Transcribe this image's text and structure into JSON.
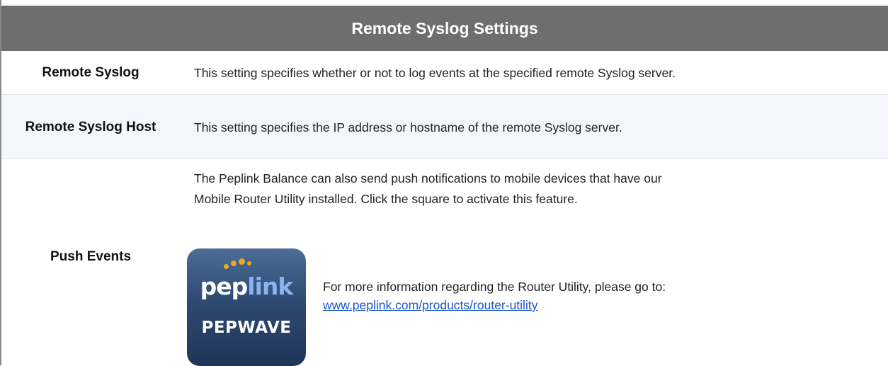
{
  "header": {
    "title": "Remote Syslog Settings"
  },
  "rows": [
    {
      "label": "Remote Syslog",
      "description": "This setting specifies whether or not to log events at the specified remote Syslog server."
    },
    {
      "label": "Remote Syslog Host",
      "description": "This setting specifies the IP address or hostname of the remote Syslog server."
    },
    {
      "label": "Push Events",
      "intro": "The Peplink Balance can also send push notifications to mobile devices that have our Mobile Router Utility installed. Click the square to activate this feature.",
      "more_info": "For more information regarding the Router Utility, please go to:",
      "link_text": "www.peplink.com/products/router-utility",
      "app_icon": {
        "icon": "peplink-pepwave-app-icon",
        "brand_prefix": "pep",
        "brand_suffix": "link",
        "subtitle": "PEPWAVE"
      }
    }
  ],
  "colors": {
    "header_bg": "#6e6e6e",
    "alt_row_bg": "#f3f6fc",
    "link": "#1a56cc",
    "icon_dots": "#f0a71e"
  }
}
